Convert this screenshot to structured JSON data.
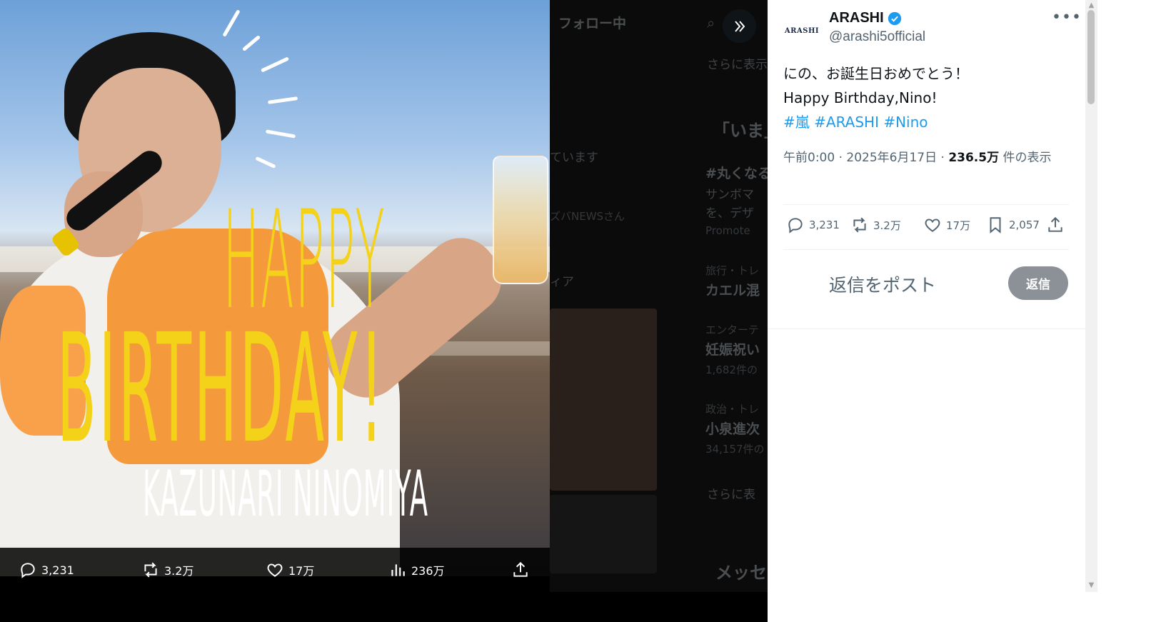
{
  "background_page": {
    "header_tab": "フォロー中",
    "show_more_1": "さらに表示",
    "section_heading": "「いま」",
    "trend_line_1": "ています",
    "trend_tag": "#丸くなる",
    "trend_line_2": "サンボマ",
    "trend_line_3": "を、デザ",
    "trend_line_4": "ズバNEWSさん",
    "promoted": "Promote",
    "trend_line_5": "ィア",
    "cat_1": "旅行・トレ",
    "topic_1": "カエル混",
    "cat_2": "エンターテ",
    "topic_2": "妊娠祝い",
    "count_2": "1,682件の",
    "cat_3": "政治・トレ",
    "topic_3": "小泉進次",
    "count_3": "34,157件の",
    "show_more_2": "さらに表",
    "messages": "メッセ"
  },
  "media": {
    "art_happy": "HAPPY",
    "art_birthday": "BIRTHDAY!",
    "art_name": "KAZUNARI NINOMIYA",
    "actions": {
      "replies": "3,231",
      "reposts": "3.2万",
      "likes": "17万",
      "views": "236万"
    }
  },
  "tweet": {
    "avatar_text": "ARASHI",
    "author_name": "ARASHI",
    "handle": "@arashi5official",
    "text_line_1": "にの、お誕生日おめでとう！",
    "text_line_2": "Happy Birthday,Nino!",
    "hashtags": [
      "#嵐",
      "#ARASHI",
      "#Nino"
    ],
    "time": "午前0:00 · 2025年6月17日 · ",
    "views_count": "236.5万",
    "views_label": " 件の表示",
    "stats": {
      "replies": "3,231",
      "reposts": "3.2万",
      "likes": "17万",
      "bookmarks": "2,057"
    },
    "reply_placeholder": "返信をポスト",
    "reply_button": "返信"
  },
  "colors": {
    "accent": "#1d9bf0",
    "art_yellow": "#f4d21a",
    "text_primary": "#0f1419",
    "text_secondary": "#536471",
    "reply_button_bg": "#8b9196"
  },
  "icons": [
    "reply-icon",
    "repost-icon",
    "like-icon",
    "views-icon",
    "share-icon",
    "bookmark-icon",
    "verified-icon",
    "more-icon",
    "expand-icon"
  ]
}
